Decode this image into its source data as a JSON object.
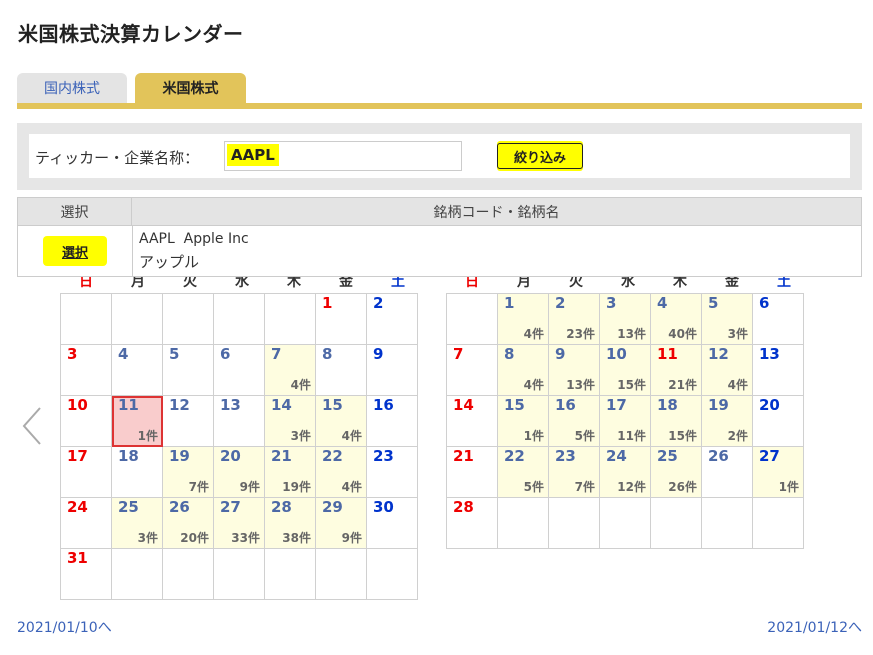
{
  "page": {
    "title": "米国株式決算カレンダー"
  },
  "tabs": [
    {
      "label": "国内株式",
      "active": false
    },
    {
      "label": "米国株式",
      "active": true
    }
  ],
  "filter": {
    "label": "ティッカー・企業名称：",
    "value": "AAPL",
    "button": "絞り込み"
  },
  "results": {
    "headers": [
      "選択",
      "銘柄コード・銘柄名"
    ],
    "rows": [
      {
        "select_label": "選択",
        "code_line": "AAPL  Apple Inc",
        "kana": "アップル"
      }
    ]
  },
  "weekdays": [
    "日",
    "月",
    "火",
    "水",
    "木",
    "金",
    "土"
  ],
  "calendars": [
    {
      "weeks": [
        [
          null,
          null,
          null,
          null,
          null,
          {
            "d": "1"
          },
          {
            "d": "2"
          }
        ],
        [
          {
            "d": "3"
          },
          {
            "d": "4"
          },
          {
            "d": "5"
          },
          {
            "d": "6"
          },
          {
            "d": "7",
            "c": "4件"
          },
          {
            "d": "8"
          },
          {
            "d": "9"
          }
        ],
        [
          {
            "d": "10"
          },
          {
            "d": "11",
            "c": "1件"
          },
          {
            "d": "12"
          },
          {
            "d": "13"
          },
          {
            "d": "14",
            "c": "3件"
          },
          {
            "d": "15",
            "c": "4件"
          },
          {
            "d": "16"
          }
        ],
        [
          {
            "d": "17"
          },
          {
            "d": "18"
          },
          {
            "d": "19",
            "c": "7件"
          },
          {
            "d": "20",
            "c": "9件"
          },
          {
            "d": "21",
            "c": "19件"
          },
          {
            "d": "22",
            "c": "4件"
          },
          {
            "d": "23"
          }
        ],
        [
          {
            "d": "24"
          },
          {
            "d": "25",
            "c": "3件"
          },
          {
            "d": "26",
            "c": "20件"
          },
          {
            "d": "27",
            "c": "33件"
          },
          {
            "d": "28",
            "c": "38件"
          },
          {
            "d": "29",
            "c": "9件"
          },
          {
            "d": "30"
          }
        ],
        [
          {
            "d": "31"
          },
          null,
          null,
          null,
          null,
          null,
          null
        ]
      ],
      "holidays": [
        "1"
      ],
      "today": "11"
    },
    {
      "weeks": [
        [
          null,
          {
            "d": "1",
            "c": "4件"
          },
          {
            "d": "2",
            "c": "23件"
          },
          {
            "d": "3",
            "c": "13件"
          },
          {
            "d": "4",
            "c": "40件"
          },
          {
            "d": "5",
            "c": "3件"
          },
          {
            "d": "6"
          }
        ],
        [
          {
            "d": "7"
          },
          {
            "d": "8",
            "c": "4件"
          },
          {
            "d": "9",
            "c": "13件"
          },
          {
            "d": "10",
            "c": "15件"
          },
          {
            "d": "11",
            "c": "21件"
          },
          {
            "d": "12",
            "c": "4件"
          },
          {
            "d": "13"
          }
        ],
        [
          {
            "d": "14"
          },
          {
            "d": "15",
            "c": "1件"
          },
          {
            "d": "16",
            "c": "5件"
          },
          {
            "d": "17",
            "c": "11件"
          },
          {
            "d": "18",
            "c": "15件"
          },
          {
            "d": "19",
            "c": "2件"
          },
          {
            "d": "20"
          }
        ],
        [
          {
            "d": "21"
          },
          {
            "d": "22",
            "c": "5件"
          },
          {
            "d": "23",
            "c": "7件"
          },
          {
            "d": "24",
            "c": "12件"
          },
          {
            "d": "25",
            "c": "26件"
          },
          {
            "d": "26"
          },
          {
            "d": "27",
            "c": "1件"
          }
        ],
        [
          {
            "d": "28"
          },
          null,
          null,
          null,
          null,
          null,
          null
        ]
      ],
      "holidays": [
        "11"
      ],
      "today": null
    }
  ],
  "nav": {
    "prev": "2021/01/10へ",
    "next": "2021/01/12へ"
  },
  "colors": {
    "accent": "#e2c45a",
    "highlight": "#ffff00",
    "link": "#3b62b8",
    "sunday": "#e00000",
    "saturday": "#0033cc",
    "weekday": "#4d69a6",
    "event_cell": "#fefde0",
    "today_cell": "#f9cccc"
  }
}
